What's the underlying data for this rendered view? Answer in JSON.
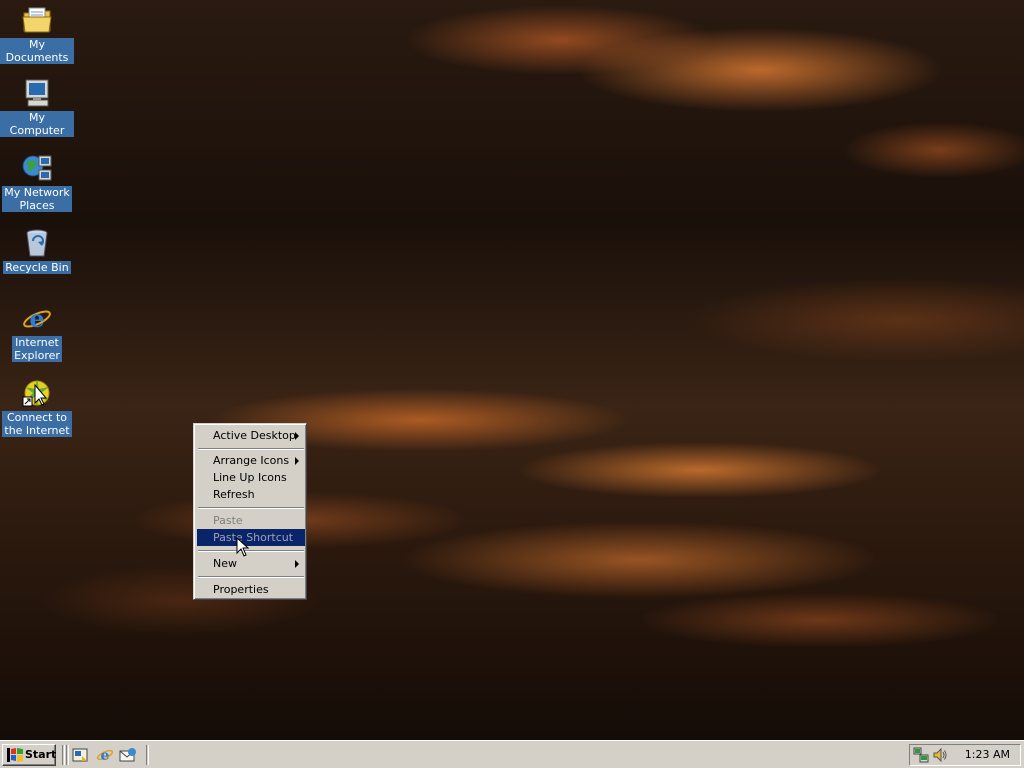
{
  "desktop": {
    "icons": [
      {
        "label": "My Documents",
        "icon": "folder-documents-icon"
      },
      {
        "label": "My Computer",
        "icon": "computer-icon"
      },
      {
        "label": "My Network\nPlaces",
        "icon": "network-places-icon"
      },
      {
        "label": "Recycle Bin",
        "icon": "recycle-bin-icon"
      },
      {
        "label": "Internet\nExplorer",
        "icon": "internet-explorer-icon"
      },
      {
        "label": "Connect to\nthe Internet",
        "icon": "connect-internet-icon"
      }
    ]
  },
  "context_menu": {
    "items": [
      {
        "label": "Active Desktop",
        "submenu": true,
        "enabled": true
      },
      {
        "label": "Arrange Icons",
        "submenu": true,
        "enabled": true
      },
      {
        "label": "Line Up Icons",
        "submenu": false,
        "enabled": true
      },
      {
        "label": "Refresh",
        "submenu": false,
        "enabled": true
      },
      {
        "label": "Paste",
        "submenu": false,
        "enabled": false
      },
      {
        "label": "Paste Shortcut",
        "submenu": false,
        "enabled": false,
        "highlighted": true
      },
      {
        "label": "New",
        "submenu": true,
        "enabled": true
      },
      {
        "label": "Properties",
        "submenu": false,
        "enabled": true
      }
    ]
  },
  "taskbar": {
    "start_label": "Start",
    "quick_launch": [
      "show-desktop-icon",
      "internet-explorer-icon",
      "outlook-express-icon"
    ],
    "tray_icons": [
      "network-connection-icon",
      "volume-icon"
    ],
    "clock": "1:23 AM"
  },
  "colors": {
    "selection": "#0a246a",
    "icon_label_bg": "#3a6ea5",
    "face": "#d4d0c8"
  }
}
